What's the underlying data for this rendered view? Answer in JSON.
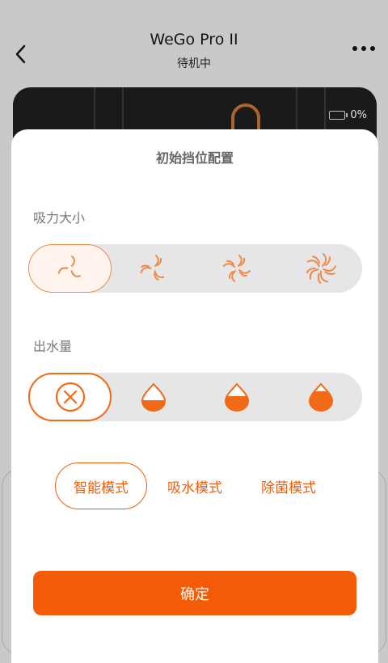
{
  "header": {
    "title": "WeGo Pro II",
    "subtitle": "待机中",
    "battery_text": "0%"
  },
  "sheet": {
    "title": "初始挡位配置",
    "suction": {
      "label": "吸力大小",
      "levels": 4,
      "selected_index": 0
    },
    "water": {
      "label": "出水量",
      "options": [
        "off",
        "low",
        "medium",
        "high"
      ],
      "selected_index": 0
    },
    "modes": {
      "items": [
        "智能模式",
        "吸水模式",
        "除菌模式"
      ],
      "selected_index": 0
    },
    "confirm_label": "确定"
  },
  "colors": {
    "accent": "#f45b07",
    "fan_icon": "#f08a4b",
    "segment_bg": "#e6e6e6"
  }
}
